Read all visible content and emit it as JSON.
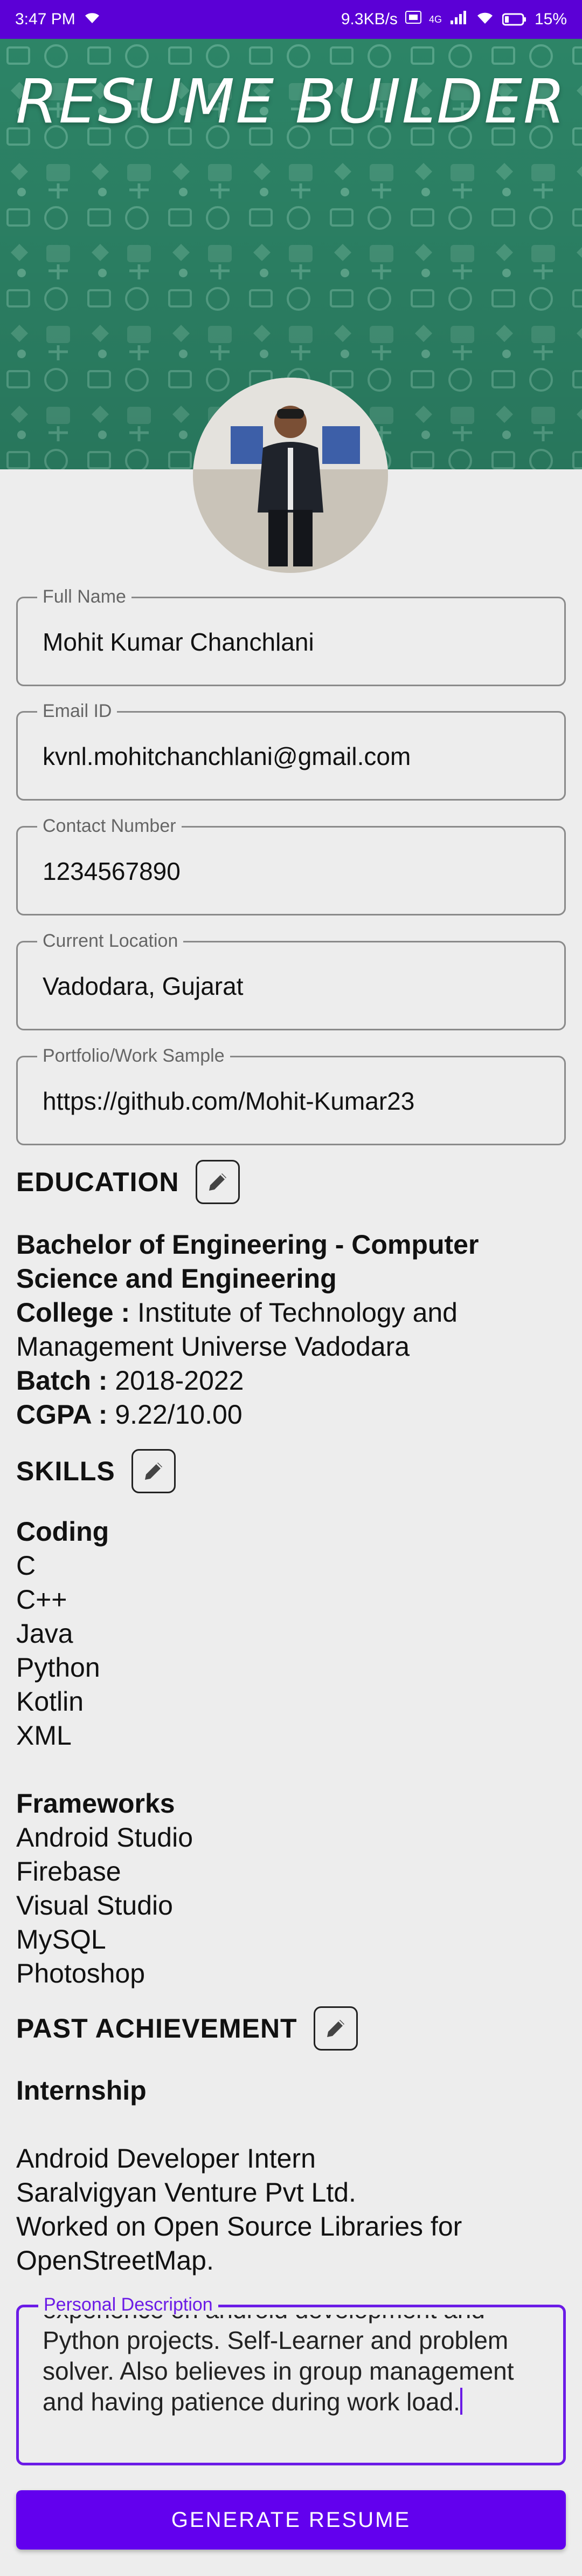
{
  "status_bar": {
    "time": "3:47 PM",
    "network_speed": "9.3KB/s",
    "network_type": "4G",
    "battery": "15%"
  },
  "app": {
    "title": "RESUME BUILDER"
  },
  "form": {
    "full_name": {
      "label": "Full Name",
      "value": "Mohit Kumar Chanchlani"
    },
    "email": {
      "label": "Email ID",
      "value": "kvnl.mohitchanchlani@gmail.com"
    },
    "contact": {
      "label": "Contact Number",
      "value": "1234567890"
    },
    "location": {
      "label": "Current Location",
      "value": "Vadodara, Gujarat"
    },
    "portfolio": {
      "label": "Portfolio/Work Sample",
      "value": "https://github.com/Mohit-Kumar23"
    }
  },
  "education": {
    "title": "EDUCATION",
    "degree": "Bachelor of Engineering - Computer Science and Engineering",
    "college_label": "College :",
    "college": "Institute of Technology and Management Universe Vadodara",
    "batch_label": "Batch :",
    "batch": "2018-2022",
    "cgpa_label": "CGPA :",
    "cgpa": "9.22/10.00"
  },
  "skills": {
    "title": "SKILLS",
    "coding_title": "Coding",
    "coding": [
      "C",
      "C++",
      "Java",
      "Python",
      "Kotlin",
      "XML"
    ],
    "frameworks_title": "Frameworks",
    "frameworks": [
      "Android Studio",
      "Firebase",
      "Visual Studio",
      "MySQL",
      "Photoshop"
    ]
  },
  "achievement": {
    "title": "PAST ACHIEVEMENT",
    "category": "Internship",
    "lines": [
      "Android Developer Intern",
      "Saralvigyan Venture Pvt Ltd.",
      "Worked on Open Source Libraries for OpenStreetMap."
    ]
  },
  "description": {
    "label": "Personal Description",
    "lines": [
      "experience on android development and",
      "Python projects. Self-Learner and problem",
      "solver. Also believes in group management",
      "and having patience during work load."
    ]
  },
  "generate_button": {
    "label": "GENERATE RESUME"
  },
  "colors": {
    "status_bar": "#5b00d6",
    "banner": "#2f8b6c",
    "accent": "#6200ee",
    "focus": "#6b1be6"
  },
  "icons": {
    "edit": "pencil-icon",
    "wifi": "wifi-icon",
    "signal": "signal-icon",
    "battery": "battery-icon"
  }
}
